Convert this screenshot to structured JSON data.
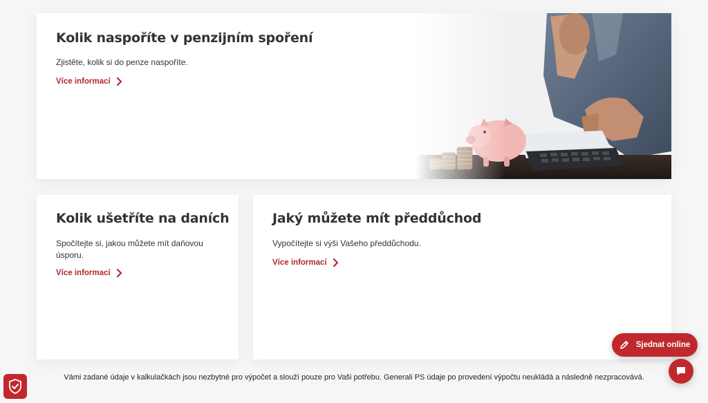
{
  "cards": {
    "pension": {
      "title": "Kolik naspoříte v penzijním spoření",
      "description": "Zjistěte, kolik si do penze naspoříte.",
      "link_label": "Více informací"
    },
    "tax": {
      "title": "Kolik ušetříte na daních",
      "description": "Spočítejte si, jakou můžete mít daňovou úsporu.",
      "link_label": "Více informací"
    },
    "preretirement": {
      "title": "Jaký můžete mít předdůchod",
      "description": "Vypočítejte si výši Vašeho předdůchodu.",
      "link_label": "Více informací"
    }
  },
  "disclaimer": "Vámi zadané údaje v kalkulačkách jsou nezbytné pro výpočet a slouží pouze pro Vaši potřebu. Generali PS údaje po provedení výpočtu neukládá a následně nezpracovává.",
  "fab": {
    "online_label": "Sjednat online",
    "online_icon": "pencil-icon",
    "chat_icon": "chat-bubble-icon"
  },
  "badge": {
    "icon": "shield-check-icon"
  },
  "colors": {
    "accent": "#c0282d",
    "link": "#b3282d",
    "background": "#f6f6f6"
  }
}
